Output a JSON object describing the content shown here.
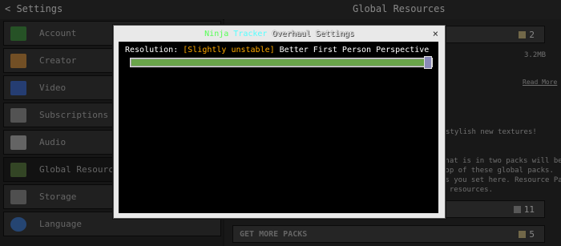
{
  "header": {
    "back_label": "< Settings",
    "title": "Global Resources"
  },
  "sidebar": {
    "items": [
      {
        "label": "Account",
        "icon": "account-icon",
        "color": "#3b7f3b"
      },
      {
        "label": "Creator",
        "icon": "creator-icon",
        "color": "#b07a3a"
      },
      {
        "label": "Video",
        "icon": "video-icon",
        "color": "#3a5fb0"
      },
      {
        "label": "Subscriptions",
        "icon": "subscriptions-icon",
        "color": "#808080"
      },
      {
        "label": "Audio",
        "icon": "audio-icon",
        "color": "#9a9a9a"
      },
      {
        "label": "Global Resources",
        "icon": "global-resources-icon",
        "color": "#4f6a3a",
        "selected": true
      },
      {
        "label": "Storage",
        "icon": "storage-icon",
        "color": "#7a7a7a"
      },
      {
        "label": "Language",
        "icon": "language-icon",
        "color": "#3a6ab0"
      }
    ]
  },
  "right": {
    "active_count": "2",
    "size": "3.2MB",
    "read_more": "Read More",
    "lines": [
      "stylish new textures!",
      "that is in two packs will be",
      "top of these global packs.",
      "es you set here. Resource Packs",
      "l resources."
    ],
    "available_count": "11",
    "get_more_label": "GET MORE PACKS",
    "get_more_count": "5"
  },
  "modal": {
    "title_parts": [
      "Ninja",
      "Tracker",
      "Overhaul Settings"
    ],
    "close_label": "×",
    "setting_label": "Resolution: ",
    "setting_tag": "[Slightly unstable]",
    "setting_value": " Better First Person Perspective",
    "slider_fraction": 1.0
  }
}
